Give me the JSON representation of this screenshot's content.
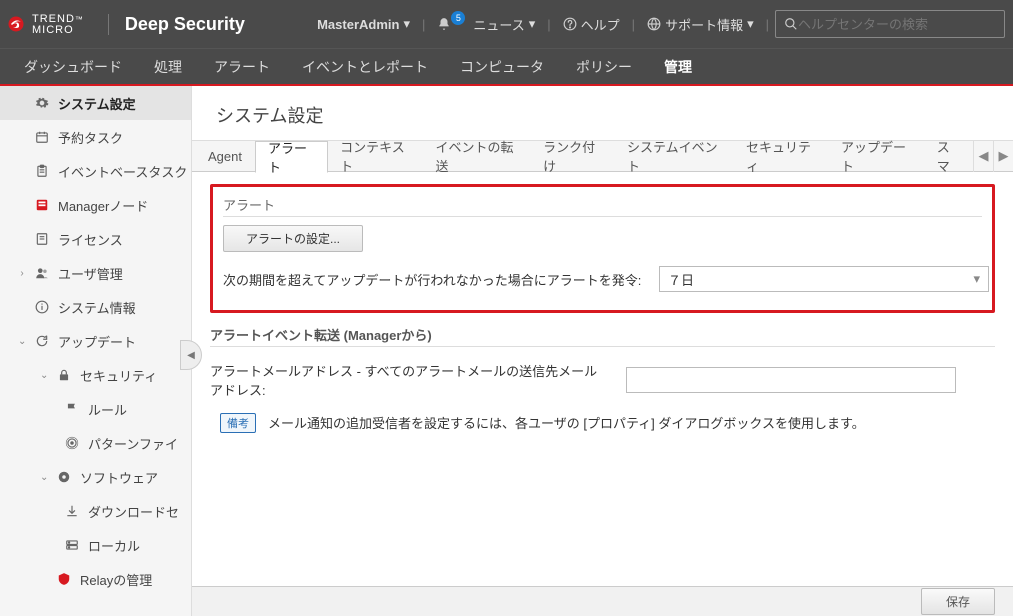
{
  "brand": {
    "line1": "TREND",
    "line2": "MICRO",
    "product": "Deep Security"
  },
  "topbar": {
    "user": "MasterAdmin",
    "news": "ニュース",
    "news_badge": "5",
    "help": "ヘルプ",
    "support": "サポート情報",
    "search_placeholder": "ヘルプセンターの検索"
  },
  "nav": {
    "items": [
      "ダッシュボード",
      "処理",
      "アラート",
      "イベントとレポート",
      "コンピュータ",
      "ポリシー",
      "管理"
    ],
    "active_index": 6
  },
  "sidebar": {
    "items": [
      {
        "label": "システム設定",
        "icon": "gear",
        "selected": true
      },
      {
        "label": "予約タスク",
        "icon": "calendar"
      },
      {
        "label": "イベントベースタスク",
        "icon": "clipboard"
      },
      {
        "label": "Managerノード",
        "icon": "manager-red"
      },
      {
        "label": "ライセンス",
        "icon": "license"
      },
      {
        "label": "ユーザ管理",
        "icon": "users",
        "expand": "right"
      },
      {
        "label": "システム情報",
        "icon": "info"
      },
      {
        "label": "アップデート",
        "icon": "update",
        "expand": "down"
      },
      {
        "label": "セキュリティ",
        "icon": "lock",
        "level": 1,
        "expand": "down"
      },
      {
        "label": "ルール",
        "icon": "flag",
        "level": 2
      },
      {
        "label": "パターンファイ",
        "icon": "pattern",
        "level": 2
      },
      {
        "label": "ソフトウェア",
        "icon": "disc",
        "level": 1,
        "expand": "down"
      },
      {
        "label": "ダウンロードセ",
        "icon": "download",
        "level": 2
      },
      {
        "label": "ローカル",
        "icon": "local",
        "level": 2
      },
      {
        "label": "Relayの管理",
        "icon": "relay-red",
        "level": 1
      }
    ]
  },
  "page_title": "システム設定",
  "tabs": {
    "items": [
      "Agent",
      "アラート",
      "コンテキスト",
      "イベントの転送",
      "ランク付け",
      "システムイベント",
      "セキュリティ",
      "アップデート",
      "スマ"
    ],
    "active_index": 1
  },
  "alert_section": {
    "legend": "アラート",
    "config_button": "アラートの設定...",
    "period_label": "次の期間を超えてアップデートが行われなかった場合にアラートを発令:",
    "period_value": "７日"
  },
  "forward_section": {
    "legend": "アラートイベント転送 (Managerから)",
    "email_label": "アラートメールアドレス - すべてのアラートメールの送信先メールアドレス:",
    "email_value": "",
    "note_badge": "備考",
    "note_text": "メール通知の追加受信者を設定するには、各ユーザの [プロパティ] ダイアログボックスを使用します。"
  },
  "footer": {
    "save": "保存"
  }
}
